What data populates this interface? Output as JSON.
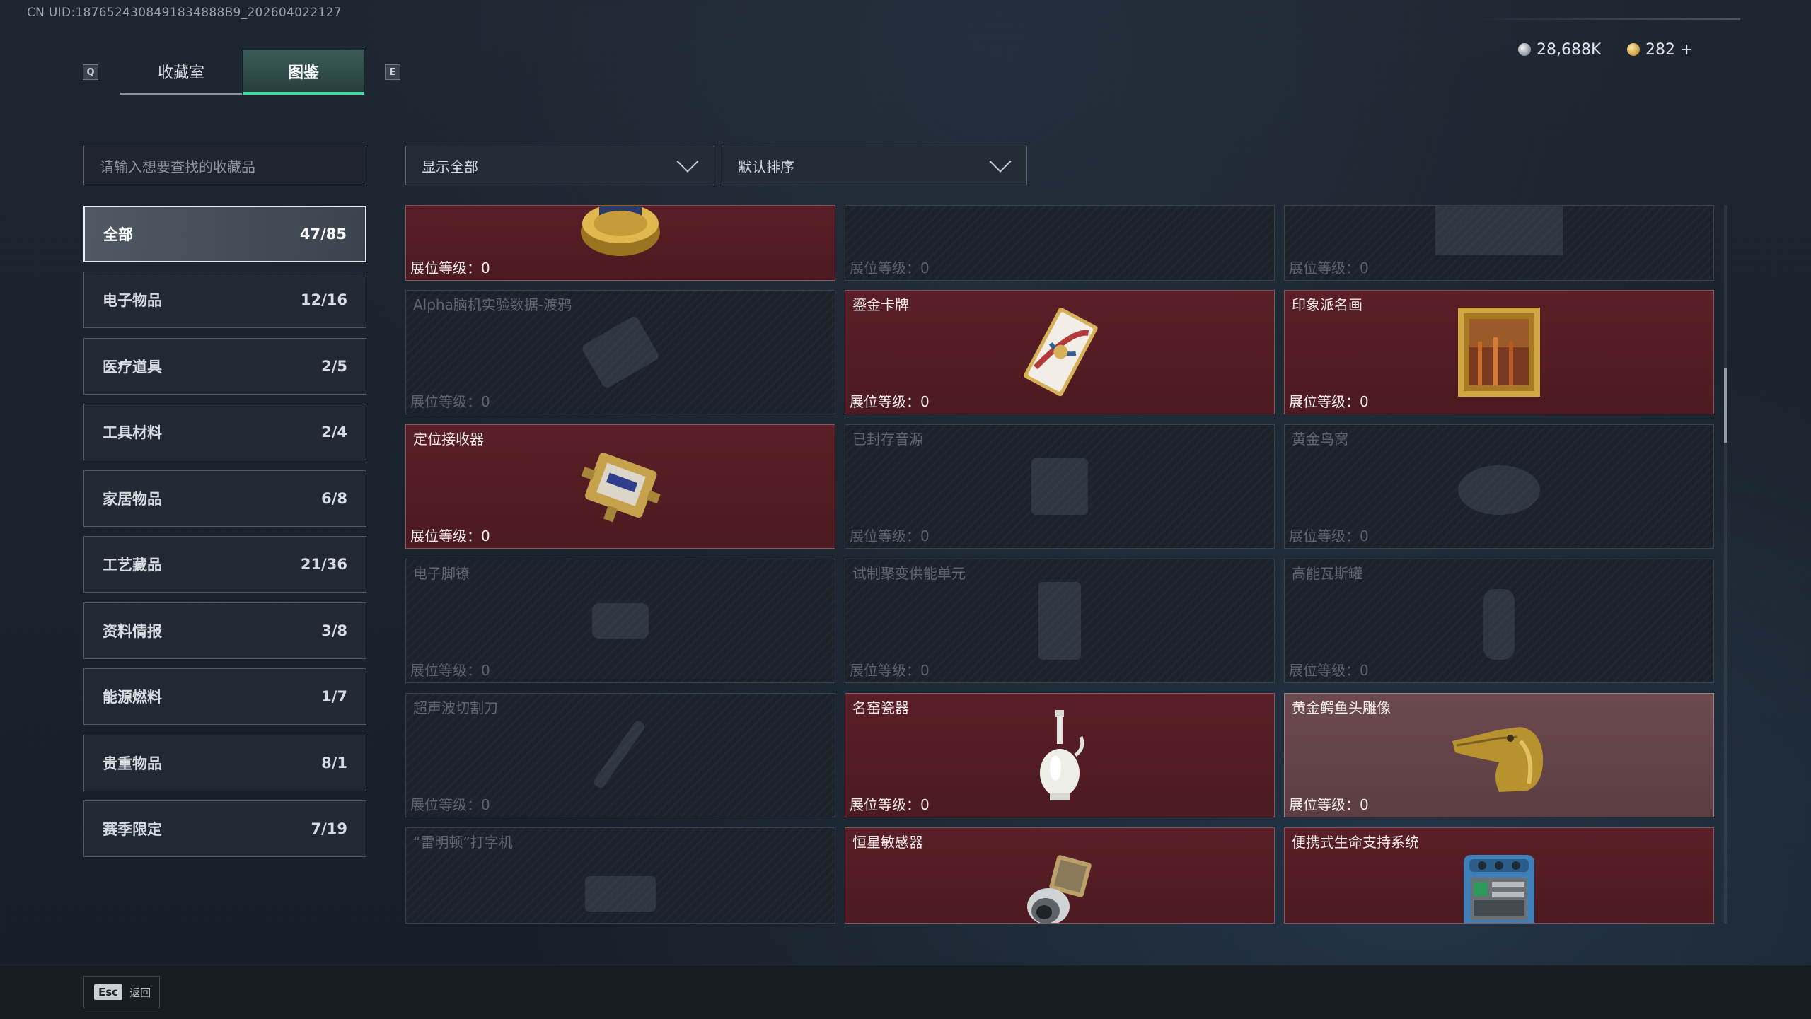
{
  "uid": "CN UID:1876524308491834888B9_202604022127",
  "tabs": {
    "prev_key": "Q",
    "next_key": "E",
    "tab1": "收藏室",
    "tab2": "图鉴"
  },
  "currency": {
    "silver": "28,688K",
    "gold": "282 +"
  },
  "search": {
    "placeholder": "请输入想要查找的收藏品"
  },
  "filters": {
    "display": "显示全部",
    "sort": "默认排序"
  },
  "categories": [
    {
      "label": "全部",
      "count": "47/85"
    },
    {
      "label": "电子物品",
      "count": "12/16"
    },
    {
      "label": "医疗道具",
      "count": "2/5"
    },
    {
      "label": "工具材料",
      "count": "2/4"
    },
    {
      "label": "家居物品",
      "count": "6/8"
    },
    {
      "label": "工艺藏品",
      "count": "21/36"
    },
    {
      "label": "资料情报",
      "count": "3/8"
    },
    {
      "label": "能源燃料",
      "count": "1/7"
    },
    {
      "label": "贵重物品",
      "count": "8/1"
    },
    {
      "label": "赛季限定",
      "count": "7/19"
    }
  ],
  "level_label": "展位等级：",
  "items": [
    {
      "name": "",
      "level": "0",
      "owned": true,
      "icon": "caviar-tin-icon"
    },
    {
      "name": "",
      "level": "0",
      "owned": false,
      "icon": "locked-item-icon"
    },
    {
      "name": "",
      "level": "0",
      "owned": false,
      "icon": "locked-item-icon"
    },
    {
      "name": "Alpha脑机实验数据-渡鸦",
      "level": "0",
      "owned": false,
      "icon": "drive-icon"
    },
    {
      "name": "鎏金卡牌",
      "level": "0",
      "owned": true,
      "icon": "gilded-card-icon"
    },
    {
      "name": "印象派名画",
      "level": "0",
      "owned": true,
      "icon": "framed-painting-icon"
    },
    {
      "name": "定位接收器",
      "level": "0",
      "owned": true,
      "icon": "locator-receiver-icon"
    },
    {
      "name": "已封存音源",
      "level": "0",
      "owned": false,
      "icon": "audio-source-icon"
    },
    {
      "name": "黄金鸟窝",
      "level": "0",
      "owned": false,
      "icon": "golden-nest-icon"
    },
    {
      "name": "电子脚镣",
      "level": "0",
      "owned": false,
      "icon": "ankle-monitor-icon"
    },
    {
      "name": "试制聚变供能单元",
      "level": "0",
      "owned": false,
      "icon": "fusion-cell-icon"
    },
    {
      "name": "高能瓦斯罐",
      "level": "0",
      "owned": false,
      "icon": "gas-canister-icon"
    },
    {
      "name": "超声波切割刀",
      "level": "0",
      "owned": false,
      "icon": "ultrasonic-cutter-icon"
    },
    {
      "name": "名窑瓷器",
      "level": "0",
      "owned": true,
      "icon": "porcelain-vase-icon"
    },
    {
      "name": "黄金鳄鱼头雕像",
      "level": "0",
      "owned": true,
      "icon": "golden-crocodile-icon"
    },
    {
      "name": "“雷明顿”打字机",
      "level": "",
      "owned": false,
      "icon": "typewriter-icon"
    },
    {
      "name": "恒星敏感器",
      "level": "",
      "owned": true,
      "icon": "star-sensor-icon"
    },
    {
      "name": "便携式生命支持系统",
      "level": "",
      "owned": true,
      "icon": "life-support-icon"
    }
  ],
  "footer": {
    "esc_key": "Esc",
    "back_label": "返回"
  }
}
